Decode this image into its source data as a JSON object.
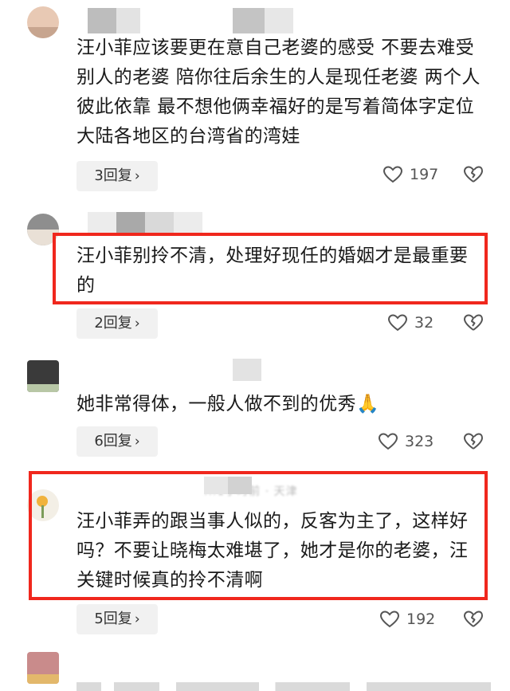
{
  "comments": [
    {
      "text": "汪小菲应该要更在意自己老婆的感受 不要去难受别人的老婆 陪你往后余生的人是现任老婆 两个人彼此依靠 最不想他俩幸福好的是写着简体字定位大陆各地区的台湾省的湾娃",
      "replies": "3回复",
      "likes": "197",
      "highlighted": false
    },
    {
      "text": "汪小菲别拎不清，处理好现任的婚姻才是最重要的",
      "replies": "2回复",
      "likes": "32",
      "highlighted": true
    },
    {
      "text": "她非常得体，一般人做不到的优秀🙏",
      "replies": "6回复",
      "likes": "323",
      "highlighted": false
    },
    {
      "text": "汪小菲弄的跟当事人似的，反客为主了，这样好吗？不要让晓梅太难堪了，她才是你的老婆，汪关键时候真的拎不清啊",
      "username_partial": "...1小时前 · 天津",
      "replies": "5回复",
      "likes": "192",
      "highlighted": true
    }
  ],
  "icons": {
    "like": "heart-outline-icon",
    "dislike": "broken-heart-icon",
    "chevron": "chevron-right-icon"
  },
  "colors": {
    "highlight_border": "#f0271d",
    "reply_pill_bg": "#f1f1f1",
    "icon_gray": "#555555"
  },
  "glyphs": {
    "chevron": "›"
  }
}
